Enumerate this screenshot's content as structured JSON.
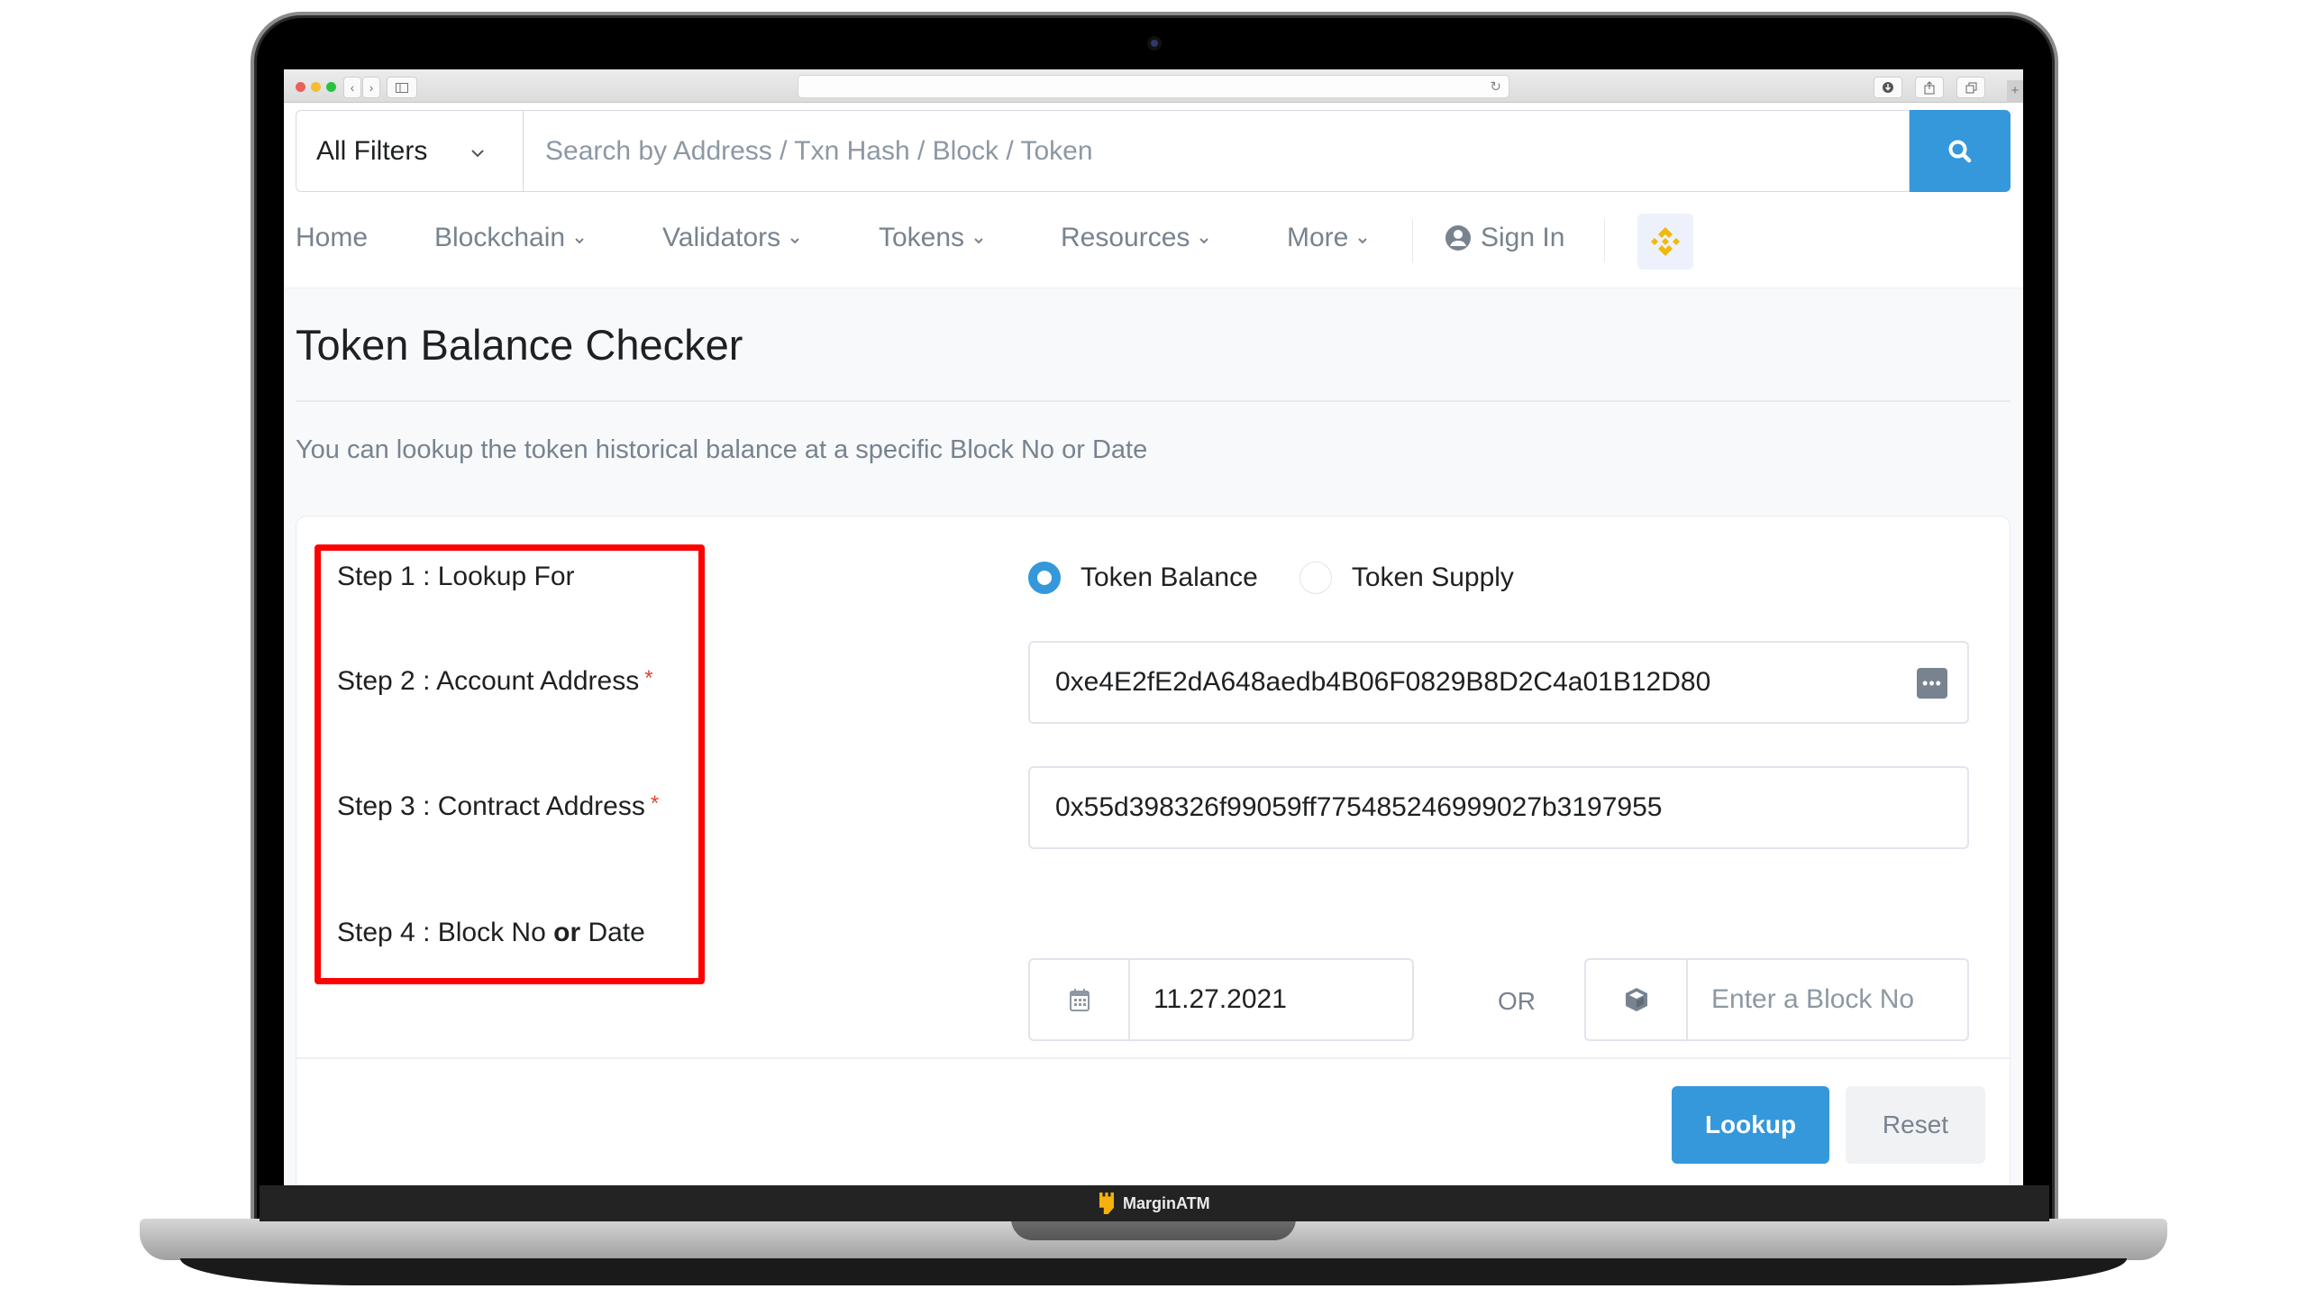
{
  "device": {
    "brand_label": "MarginATM"
  },
  "browser": {
    "tab_add_icon": "plus-icon"
  },
  "search": {
    "filter_label": "All Filters",
    "placeholder": "Search by Address / Txn Hash / Block / Token",
    "button_icon": "search-icon"
  },
  "nav": {
    "items": [
      {
        "label": "Home",
        "has_dropdown": false
      },
      {
        "label": "Blockchain",
        "has_dropdown": true
      },
      {
        "label": "Validators",
        "has_dropdown": true
      },
      {
        "label": "Tokens",
        "has_dropdown": true
      },
      {
        "label": "Resources",
        "has_dropdown": true
      },
      {
        "label": "More",
        "has_dropdown": true
      }
    ],
    "sign_in": "Sign In",
    "caret": "⌄"
  },
  "page": {
    "title": "Token Balance Checker",
    "subtitle": "You can lookup the token historical balance at a specific Block No or Date"
  },
  "form": {
    "steps": [
      {
        "label": "Step 1 : Lookup For",
        "required": false
      },
      {
        "label": "Step 2 : Account Address",
        "required": true
      },
      {
        "label": "Step 3 : Contract Address",
        "required": true
      },
      {
        "label_prefix": "Step 4 : Block No ",
        "label_bold": "or",
        "label_suffix": " Date",
        "required": false
      }
    ],
    "required_mark": "*",
    "lookup_options": [
      {
        "label": "Token Balance",
        "checked": true
      },
      {
        "label": "Token Supply",
        "checked": false
      }
    ],
    "account_address": "0xe4E2fE2dA648aedb4B06F0829B8D2C4a01B12D80",
    "contract_address": "0x55d398326f99059ff775485246999027b3197955",
    "date_value": "11.27.2021",
    "or_label": "OR",
    "block_placeholder": "Enter a Block No",
    "lookup_button": "Lookup",
    "reset_button": "Reset"
  },
  "colors": {
    "primary": "#3498db",
    "highlight_box": "#ff0000",
    "required": "#de4437",
    "bnb_logo": "#f0b90b"
  }
}
